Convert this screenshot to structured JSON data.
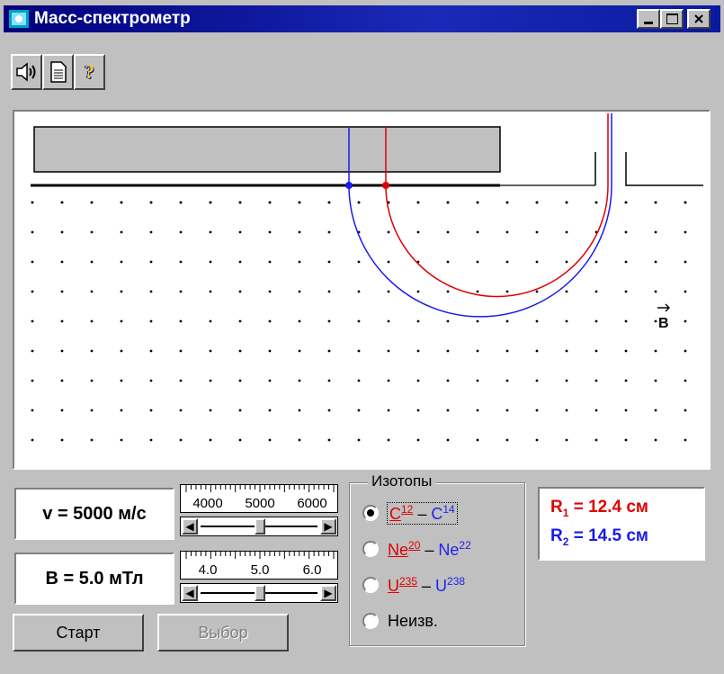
{
  "window": {
    "title": "Масс-спектрометр",
    "accent": "#0a1a9e"
  },
  "title_buttons": {
    "minimize_icon": "minimize-icon",
    "maximize_icon": "maximize-icon",
    "close_icon": "close-icon"
  },
  "toolbar": {
    "items": [
      {
        "icon": "speaker-icon"
      },
      {
        "icon": "document-icon"
      },
      {
        "icon": "help-icon",
        "label": "?"
      }
    ]
  },
  "canvas": {
    "field_label": "B",
    "colors": {
      "ion1": "#e00000",
      "ion2": "#1a1aee"
    }
  },
  "controls": {
    "velocity": {
      "label": "v = 5000 м/с",
      "value": 5000,
      "ticks": [
        "4000",
        "5000",
        "6000"
      ],
      "slider_fraction": 0.5
    },
    "field": {
      "label": "B = 5.0 мТл",
      "value": 5.0,
      "ticks": [
        "4.0",
        "5.0",
        "6.0"
      ],
      "slider_fraction": 0.5
    }
  },
  "isotopes": {
    "title": "Изотопы",
    "options": [
      {
        "a": "C",
        "a_mass": "12",
        "sep": " – ",
        "b": "C",
        "b_mass": "14",
        "selected": true
      },
      {
        "a": "Ne",
        "a_mass": "20",
        "sep": " – ",
        "b": "Ne",
        "b_mass": "22",
        "selected": false
      },
      {
        "a": "U",
        "a_mass": "235",
        "sep": " – ",
        "b": "U",
        "b_mass": "238",
        "selected": false
      },
      {
        "label": "Неизв.",
        "selected": false
      }
    ]
  },
  "results": {
    "r1_symbol": "R",
    "r1_sub": "1",
    "r1_value": " = 12.4 см",
    "r2_symbol": "R",
    "r2_sub": "2",
    "r2_value": " = 14.5 см"
  },
  "buttons": {
    "start": "Старт",
    "select": "Выбор"
  }
}
